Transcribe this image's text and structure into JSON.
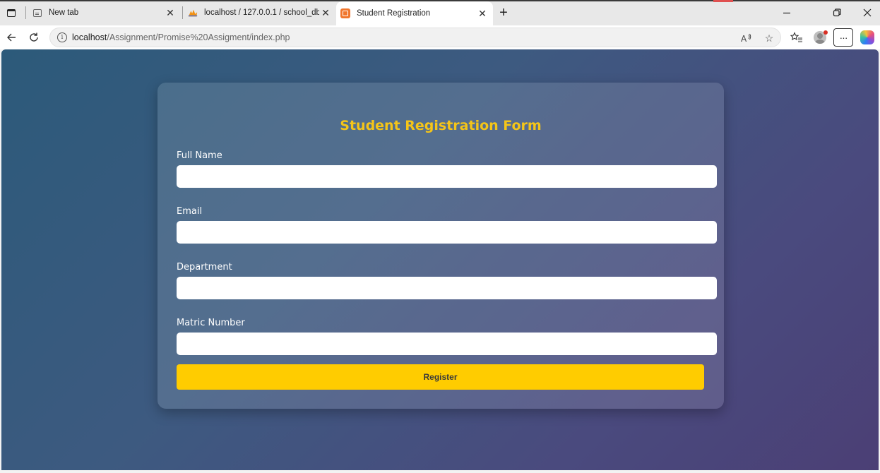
{
  "browser": {
    "tabs": [
      {
        "title": "New tab",
        "icon": "new-tab-page-icon",
        "active": false
      },
      {
        "title": "localhost / 127.0.0.1 / school_db /",
        "icon": "phpmyadmin-icon",
        "active": false
      },
      {
        "title": "Student Registration",
        "icon": "xampp-icon",
        "active": true
      }
    ],
    "address_bar": {
      "host": "localhost",
      "path": "/Assignment/Promise%20Assigment/index.php"
    }
  },
  "form": {
    "title": "Student Registration Form",
    "fields": [
      {
        "label": "Full Name",
        "value": ""
      },
      {
        "label": "Email",
        "value": ""
      },
      {
        "label": "Department",
        "value": ""
      },
      {
        "label": "Matric Number",
        "value": ""
      }
    ],
    "submit_label": "Register"
  },
  "colors": {
    "accent": "#ffcc00",
    "title_color": "#f5c518",
    "background_gradient": [
      "#2c5a7a",
      "#4b3f75"
    ]
  }
}
